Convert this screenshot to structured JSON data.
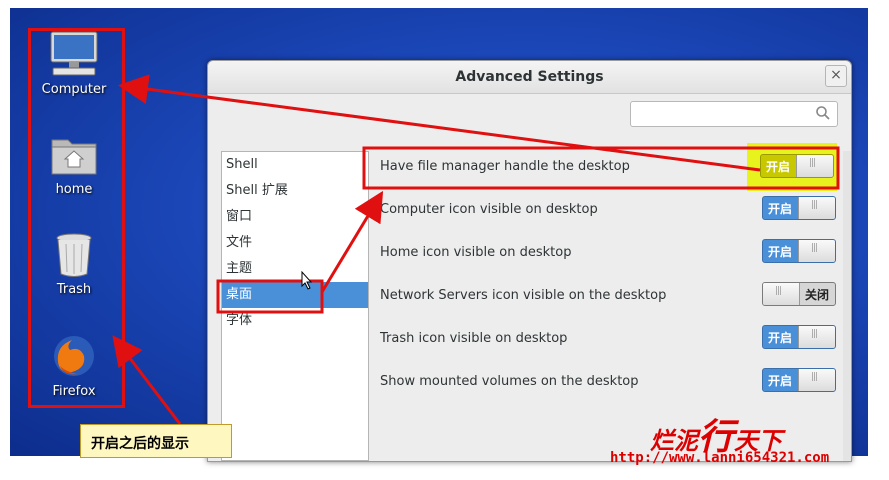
{
  "desktop": {
    "icons": [
      {
        "label": "Computer",
        "icon": "computer-icon"
      },
      {
        "label": "home",
        "icon": "folder-home-icon"
      },
      {
        "label": "Trash",
        "icon": "trash-icon"
      },
      {
        "label": "Firefox",
        "icon": "firefox-icon"
      }
    ]
  },
  "window": {
    "title": "Advanced Settings",
    "close_label": "×",
    "search": {
      "placeholder": "",
      "value": ""
    },
    "sidebar": {
      "items": [
        "Shell",
        "Shell 扩展",
        "窗口",
        "文件",
        "主题",
        "桌面",
        "字体"
      ],
      "selected": "桌面"
    },
    "settings": [
      {
        "label": "Have file manager handle the desktop",
        "state": "开启",
        "on": true
      },
      {
        "label": "Computer icon visible on desktop",
        "state": "开启",
        "on": true
      },
      {
        "label": "Home icon visible on desktop",
        "state": "开启",
        "on": true
      },
      {
        "label": "Network Servers icon visible on the desktop",
        "state": "关闭",
        "on": false
      },
      {
        "label": "Trash icon visible on desktop",
        "state": "开启",
        "on": true
      },
      {
        "label": "Show mounted volumes on the desktop",
        "state": "开启",
        "on": true
      }
    ]
  },
  "annotation": {
    "callout": "开启之后的显示",
    "watermark_1": "烂泥",
    "watermark_2": "行",
    "watermark_3": "天下",
    "url": "http://www.lanni654321.com",
    "accent_red": "#e01010",
    "highlight_yellow": "#e8f21c"
  }
}
